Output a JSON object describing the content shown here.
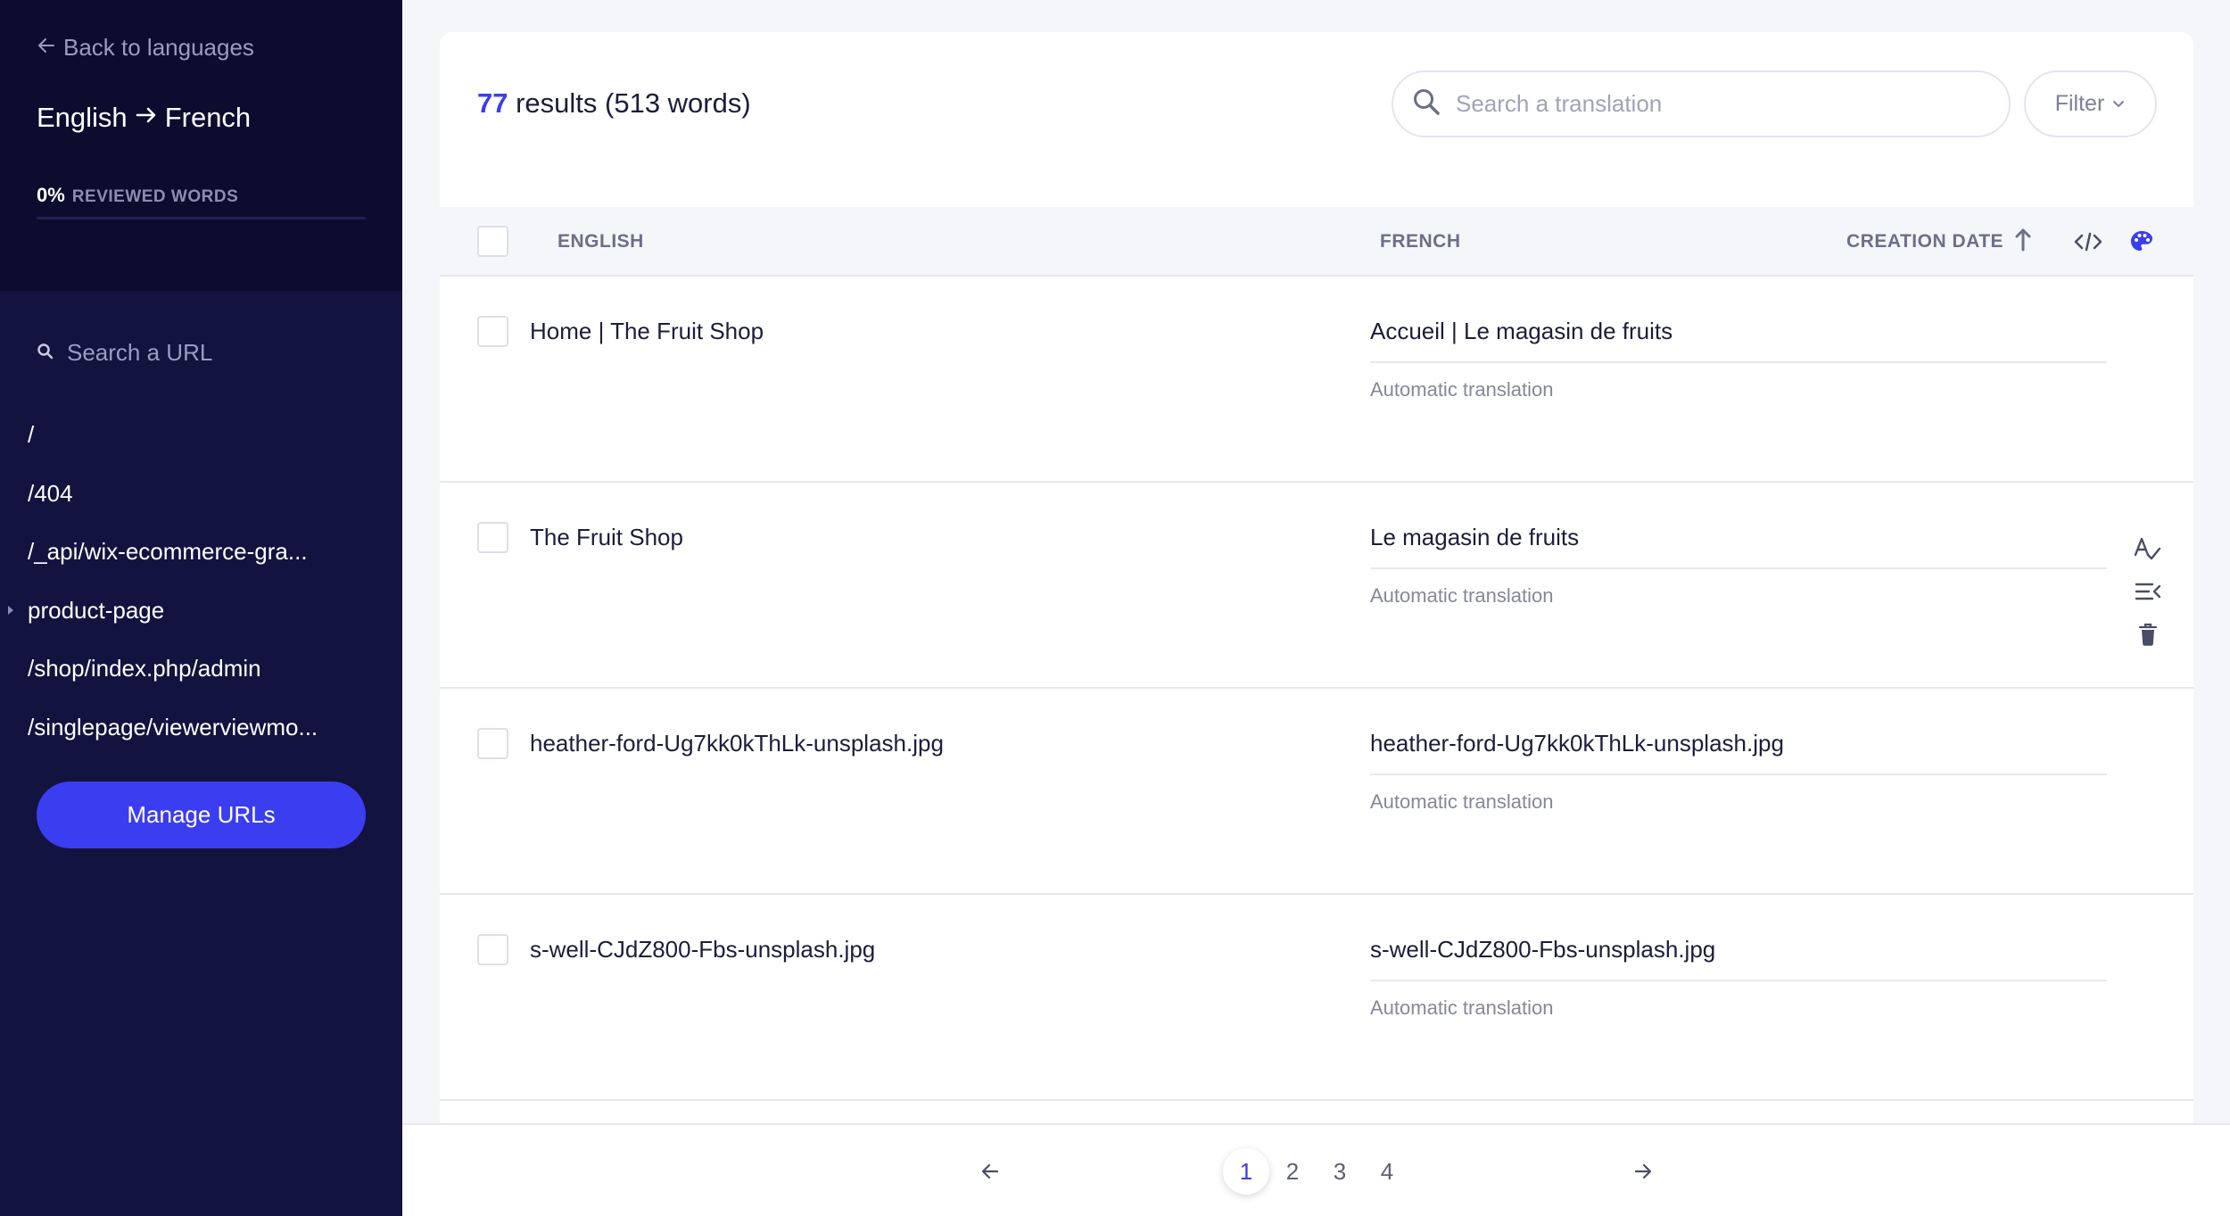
{
  "sidebar": {
    "back_label": "Back to languages",
    "source_lang": "English",
    "target_lang": "French",
    "reviewed_pct": "0%",
    "reviewed_label": "REVIEWED WORDS",
    "reviewed_fraction": 0,
    "url_search_label": "Search a URL",
    "urls": [
      {
        "label": "/",
        "expandable": false
      },
      {
        "label": "/404",
        "expandable": false
      },
      {
        "label": "/_api/wix-ecommerce-gra...",
        "expandable": false
      },
      {
        "label": "product-page",
        "expandable": true
      },
      {
        "label": "/shop/index.php/admin",
        "expandable": false
      },
      {
        "label": "/singlepage/viewerviewmo...",
        "expandable": false
      }
    ],
    "manage_button": "Manage URLs"
  },
  "header": {
    "results_count": "77",
    "results_text": " results (513 words)",
    "search_placeholder": "Search a translation",
    "filter_label": "Filter"
  },
  "table": {
    "columns": {
      "source": "ENGLISH",
      "target": "FRENCH",
      "date": "CREATION DATE"
    },
    "rows": [
      {
        "source": "Home | The Fruit Shop",
        "target": "Accueil | Le magasin de fruits",
        "status": "Automatic translation"
      },
      {
        "source": "The Fruit Shop",
        "target": "Le magasin de fruits",
        "status": "Automatic translation"
      },
      {
        "source": "heather-ford-Ug7kk0kThLk-unsplash.jpg",
        "target": "heather-ford-Ug7kk0kThLk-unsplash.jpg",
        "status": "Automatic translation"
      },
      {
        "source": "s-well-CJdZ800-Fbs-unsplash.jpg",
        "target": "s-well-CJdZ800-Fbs-unsplash.jpg",
        "status": "Automatic translation"
      }
    ]
  },
  "pagination": {
    "pages": [
      "1",
      "2",
      "3",
      "4"
    ],
    "current": "1"
  },
  "colors": {
    "sidebar_bg": "#12133f",
    "accent": "#3b3df0"
  }
}
